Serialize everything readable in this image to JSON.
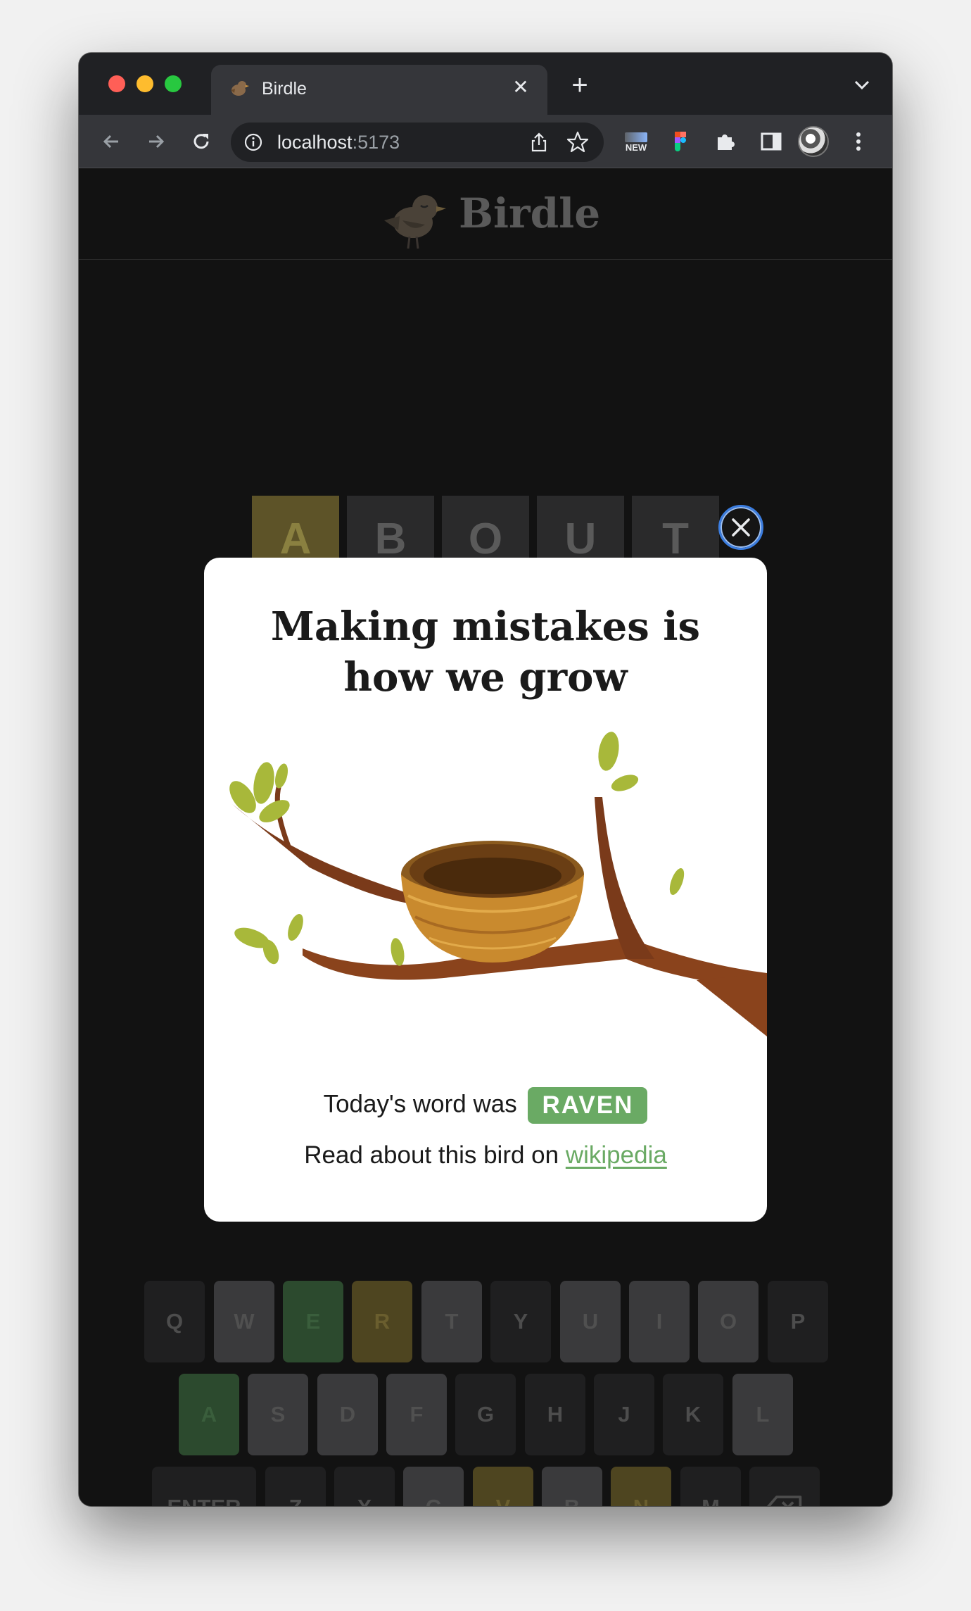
{
  "browser": {
    "tab_title": "Birdle",
    "tab_close": "✕",
    "new_tab": "+",
    "url_host": "localhost",
    "url_port": ":5173",
    "ext_new_label": "NEW"
  },
  "app": {
    "brand": "Birdle"
  },
  "board": {
    "row": [
      "A",
      "B",
      "O",
      "U",
      "T"
    ]
  },
  "modal": {
    "title": "Making mistakes is how we grow",
    "word_prefix": "Today's word was",
    "word": "RAVEN",
    "wiki_prefix": "Read about this bird on",
    "wiki_link": "wikipedia"
  },
  "keyboard": {
    "row1": [
      "Q",
      "W",
      "E",
      "R",
      "T",
      "Y",
      "U",
      "I",
      "O",
      "P"
    ],
    "row2": [
      "A",
      "S",
      "D",
      "F",
      "G",
      "H",
      "J",
      "K",
      "L"
    ],
    "row3": [
      "ENTER",
      "Z",
      "X",
      "C",
      "V",
      "B",
      "N",
      "M"
    ]
  },
  "colors": {
    "correct": "#6aaa64",
    "present": "#c9b458",
    "background": "#121212"
  }
}
